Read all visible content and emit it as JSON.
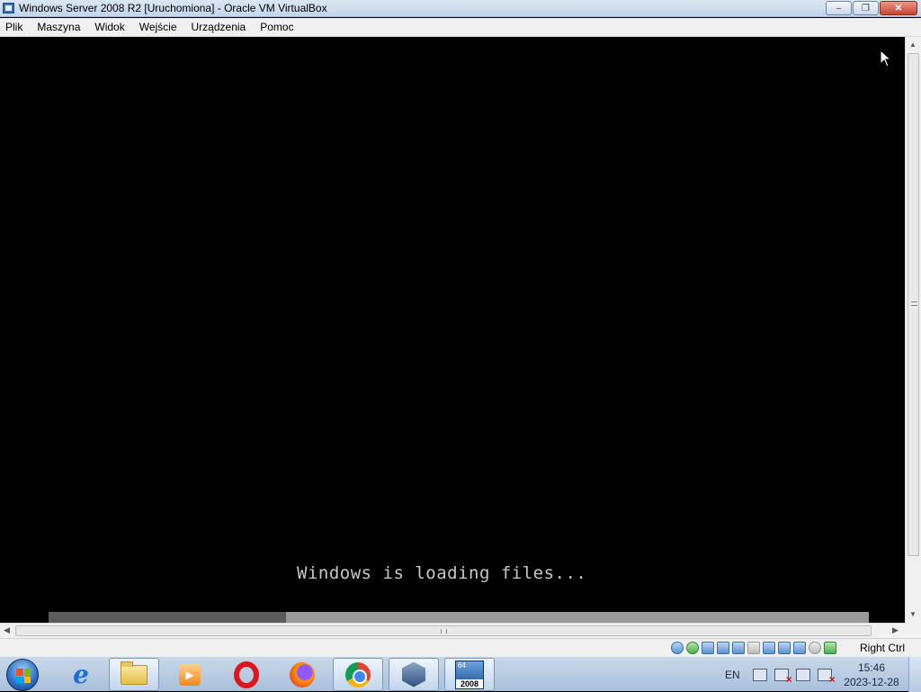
{
  "window": {
    "title": "Windows Server 2008 R2 [Uruchomiona] - Oracle VM VirtualBox",
    "buttons": {
      "minimize": "‒",
      "maximize": "❐",
      "close": "✕"
    }
  },
  "menu": {
    "items": [
      "Plik",
      "Maszyna",
      "Widok",
      "Wejście",
      "Urządzenia",
      "Pomoc"
    ]
  },
  "vm": {
    "loading_text": "Windows is loading files...",
    "progress_fraction": 0.29
  },
  "statusbar": {
    "host_key": "Right Ctrl",
    "icons": [
      "hard-disk-icon",
      "optical-drive-icon",
      "audio-icon",
      "network-icon",
      "usb-icon",
      "shared-folders-icon",
      "display-icon",
      "video-capture-icon",
      "virtualization-icon",
      "mouse-integration-icon",
      "keyboard-capture-icon"
    ]
  },
  "taskbar": {
    "pinned": [
      "internet-explorer",
      "windows-explorer",
      "media-player",
      "opera",
      "firefox",
      "chrome",
      "virtualbox",
      "windows-server-2008"
    ],
    "active": "windows-server-2008",
    "server_icon": {
      "top": "64",
      "bottom": "2008"
    },
    "tray": {
      "language": "EN",
      "time": "15:46",
      "date": "2023-12-28"
    }
  }
}
